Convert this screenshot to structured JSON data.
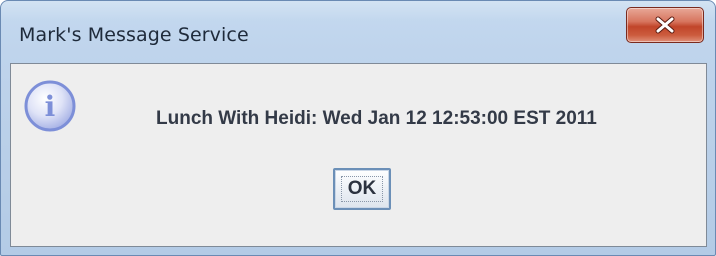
{
  "window": {
    "title": "Mark's Message Service",
    "close_icon": "close-x-icon"
  },
  "dialog": {
    "icon": "info-icon",
    "icon_glyph": "i",
    "message": "Lunch With Heidi: Wed Jan 12 12:53:00 EST 2011",
    "ok_label": "OK"
  },
  "colors": {
    "titlebar": "#bfd4ec",
    "close_button": "#c1452a",
    "client_background": "#eeeeee",
    "info_icon": "#7d8fd8"
  }
}
